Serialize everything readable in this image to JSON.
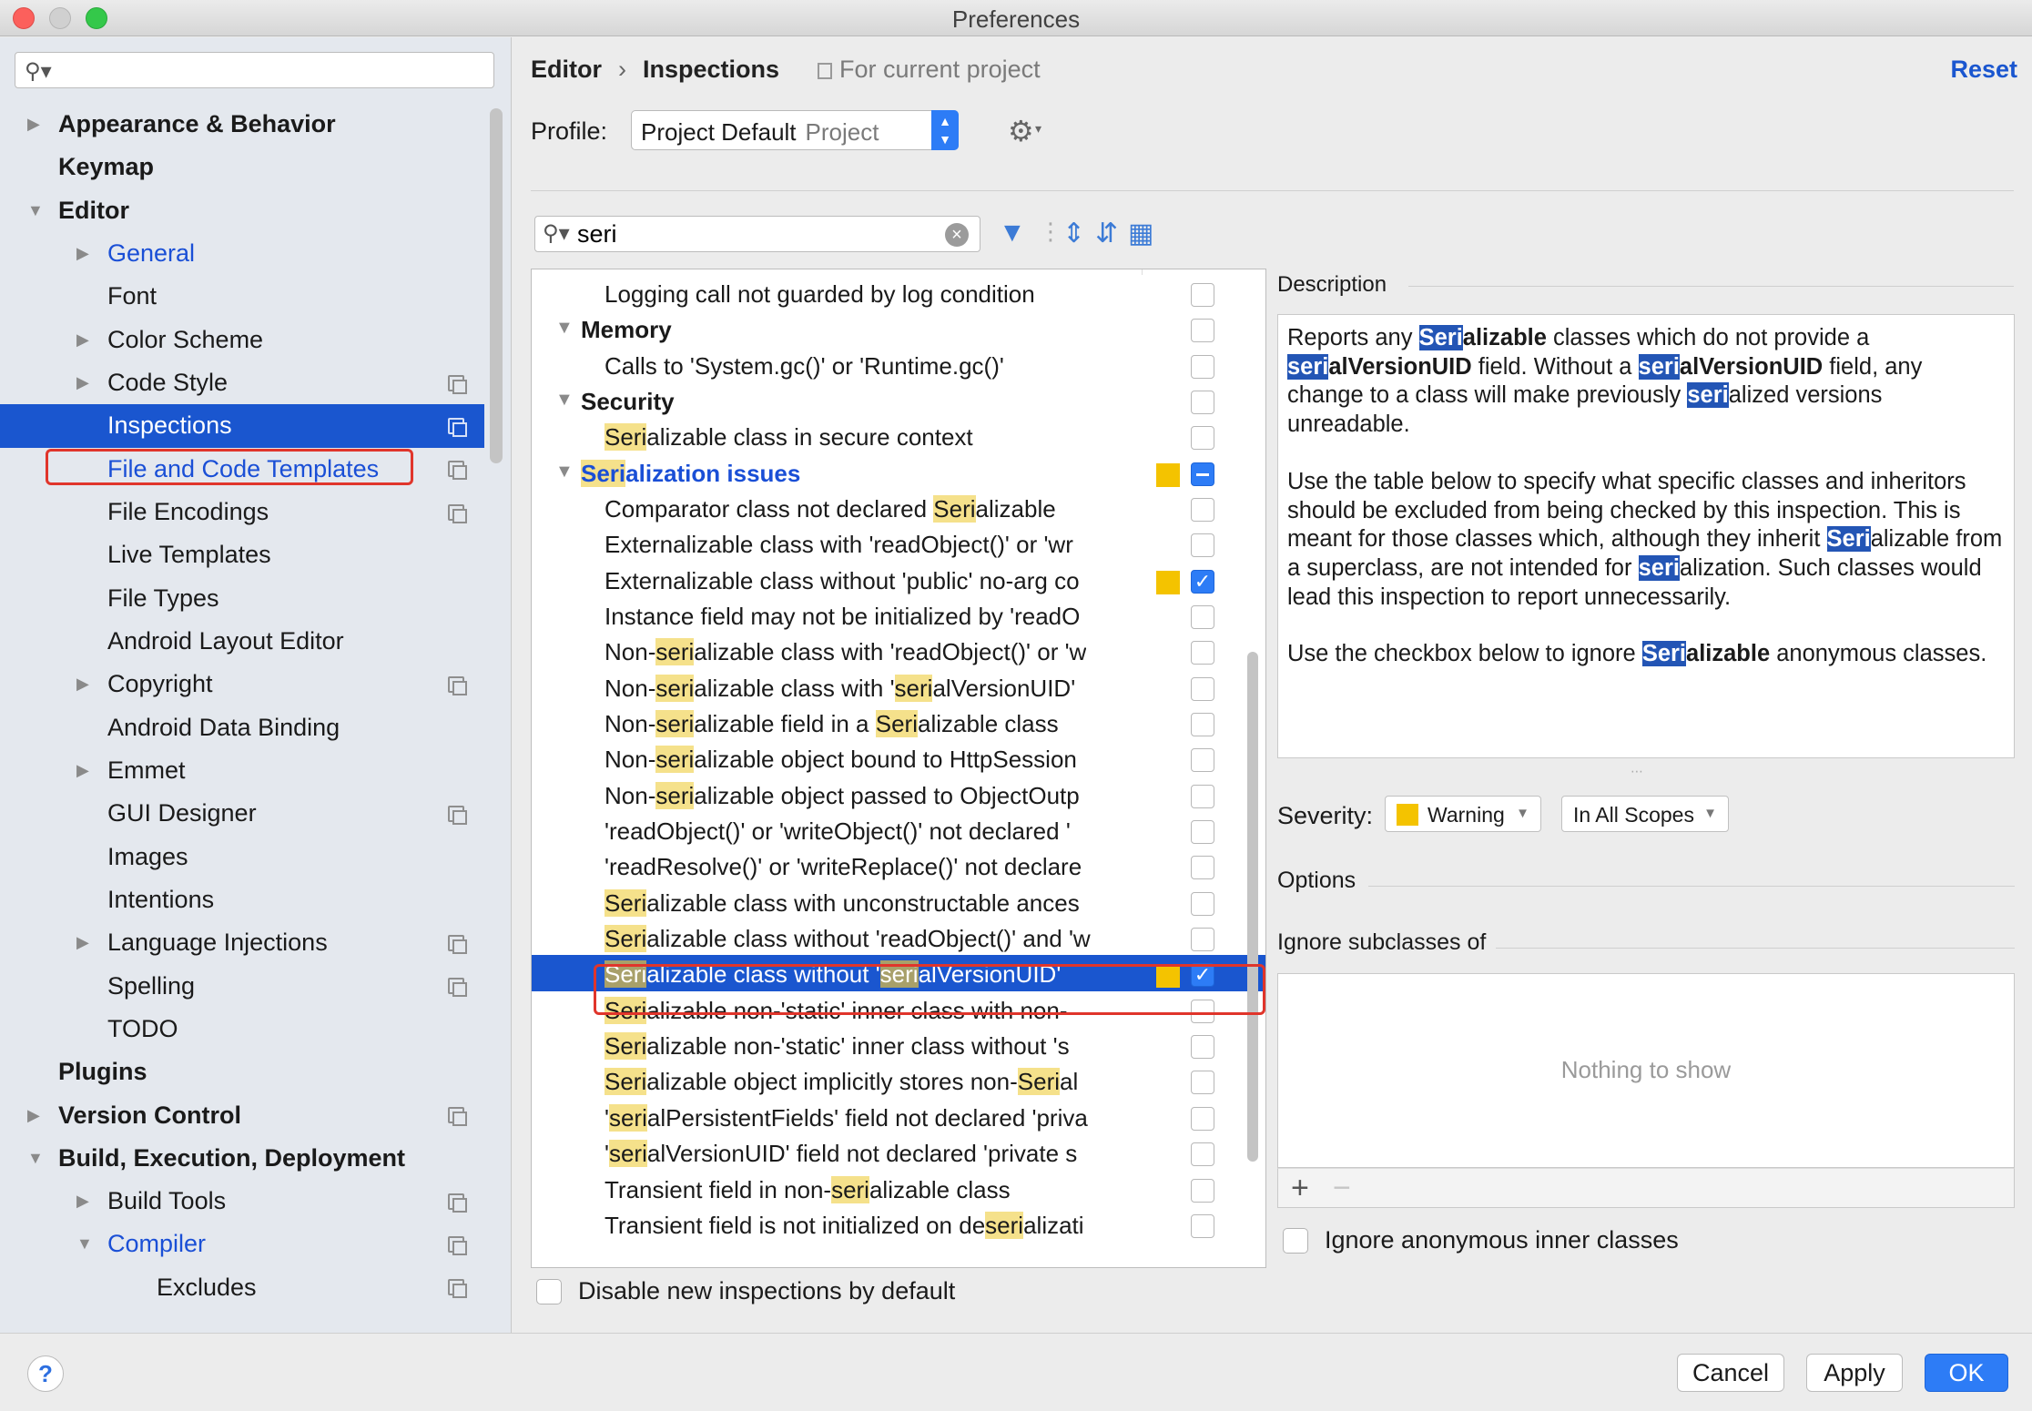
{
  "window": {
    "title": "Preferences"
  },
  "sidebar": {
    "search_placeholder": "",
    "items": [
      {
        "label": "Appearance & Behavior",
        "level": 0,
        "arrow": "right",
        "bold": true
      },
      {
        "label": "Keymap",
        "level": 0,
        "arrow": "",
        "bold": true
      },
      {
        "label": "Editor",
        "level": 0,
        "arrow": "down",
        "bold": true
      },
      {
        "label": "General",
        "level": 1,
        "arrow": "right",
        "link": true
      },
      {
        "label": "Font",
        "level": 1,
        "arrow": ""
      },
      {
        "label": "Color Scheme",
        "level": 1,
        "arrow": "right"
      },
      {
        "label": "Code Style",
        "level": 1,
        "arrow": "right",
        "copy": true
      },
      {
        "label": "Inspections",
        "level": 1,
        "arrow": "",
        "copy": true,
        "selected": true
      },
      {
        "label": "File and Code Templates",
        "level": 1,
        "arrow": "",
        "copy": true,
        "link": true
      },
      {
        "label": "File Encodings",
        "level": 1,
        "arrow": "",
        "copy": true
      },
      {
        "label": "Live Templates",
        "level": 1,
        "arrow": ""
      },
      {
        "label": "File Types",
        "level": 1,
        "arrow": ""
      },
      {
        "label": "Android Layout Editor",
        "level": 1,
        "arrow": ""
      },
      {
        "label": "Copyright",
        "level": 1,
        "arrow": "right",
        "copy": true
      },
      {
        "label": "Android Data Binding",
        "level": 1,
        "arrow": ""
      },
      {
        "label": "Emmet",
        "level": 1,
        "arrow": "right"
      },
      {
        "label": "GUI Designer",
        "level": 1,
        "arrow": "",
        "copy": true
      },
      {
        "label": "Images",
        "level": 1,
        "arrow": ""
      },
      {
        "label": "Intentions",
        "level": 1,
        "arrow": ""
      },
      {
        "label": "Language Injections",
        "level": 1,
        "arrow": "right",
        "copy": true
      },
      {
        "label": "Spelling",
        "level": 1,
        "arrow": "",
        "copy": true
      },
      {
        "label": "TODO",
        "level": 1,
        "arrow": ""
      },
      {
        "label": "Plugins",
        "level": 0,
        "arrow": "",
        "bold": true
      },
      {
        "label": "Version Control",
        "level": 0,
        "arrow": "right",
        "bold": true,
        "copy": true
      },
      {
        "label": "Build, Execution, Deployment",
        "level": 0,
        "arrow": "down",
        "bold": true
      },
      {
        "label": "Build Tools",
        "level": 1,
        "arrow": "right",
        "copy": true
      },
      {
        "label": "Compiler",
        "level": 1,
        "arrow": "down",
        "copy": true,
        "link": true
      },
      {
        "label": "Excludes",
        "level": 2,
        "arrow": "",
        "copy": true
      }
    ]
  },
  "header": {
    "crumb1": "Editor",
    "crumb_sep": "›",
    "crumb2": "Inspections",
    "scope_note": "For current project",
    "reset": "Reset"
  },
  "profile": {
    "label": "Profile:",
    "value": "Project Default",
    "scope": "Project"
  },
  "filter": {
    "value": "seri"
  },
  "inspections": [
    {
      "segments": [
        {
          "t": "Logging call not guarded by log condition"
        }
      ],
      "level": 1,
      "cb": "off"
    },
    {
      "segments": [
        {
          "t": "Memory"
        }
      ],
      "level": 0,
      "arrow": "down",
      "bold": true,
      "cb": "off"
    },
    {
      "segments": [
        {
          "t": "Calls to 'System.gc()' or 'Runtime.gc()'"
        }
      ],
      "level": 1,
      "cb": "off"
    },
    {
      "segments": [
        {
          "t": "Security"
        }
      ],
      "level": 0,
      "arrow": "down",
      "bold": true,
      "cb": "off"
    },
    {
      "segments": [
        {
          "t": "Seri",
          "hl": true
        },
        {
          "t": "alizable class in secure context"
        }
      ],
      "level": 1,
      "cb": "off"
    },
    {
      "segments": [
        {
          "t": "Seri",
          "hl": true
        },
        {
          "t": "alization issues"
        }
      ],
      "level": 0,
      "arrow": "down",
      "bold": true,
      "link": true,
      "sev": true,
      "cb": "mixed"
    },
    {
      "segments": [
        {
          "t": "Comparator class not declared "
        },
        {
          "t": "Seri",
          "hl": true
        },
        {
          "t": "alizable"
        }
      ],
      "level": 1,
      "cb": "off"
    },
    {
      "segments": [
        {
          "t": "Externalizable class with 'readObject()' or 'wr"
        }
      ],
      "level": 1,
      "cb": "off"
    },
    {
      "segments": [
        {
          "t": "Externalizable class without 'public' no-arg co"
        }
      ],
      "level": 1,
      "sev": true,
      "cb": "on"
    },
    {
      "segments": [
        {
          "t": "Instance field may not be initialized by 'readO"
        }
      ],
      "level": 1,
      "cb": "off"
    },
    {
      "segments": [
        {
          "t": "Non-"
        },
        {
          "t": "seri",
          "hl": true
        },
        {
          "t": "alizable class with 'readObject()' or 'w"
        }
      ],
      "level": 1,
      "cb": "off"
    },
    {
      "segments": [
        {
          "t": "Non-"
        },
        {
          "t": "seri",
          "hl": true
        },
        {
          "t": "alizable class with '"
        },
        {
          "t": "seri",
          "hl": true
        },
        {
          "t": "alVersionUID'"
        }
      ],
      "level": 1,
      "cb": "off"
    },
    {
      "segments": [
        {
          "t": "Non-"
        },
        {
          "t": "seri",
          "hl": true
        },
        {
          "t": "alizable field in a "
        },
        {
          "t": "Seri",
          "hl": true
        },
        {
          "t": "alizable class"
        }
      ],
      "level": 1,
      "cb": "off"
    },
    {
      "segments": [
        {
          "t": "Non-"
        },
        {
          "t": "seri",
          "hl": true
        },
        {
          "t": "alizable object bound to HttpSession"
        }
      ],
      "level": 1,
      "cb": "off"
    },
    {
      "segments": [
        {
          "t": "Non-"
        },
        {
          "t": "seri",
          "hl": true
        },
        {
          "t": "alizable object passed to ObjectOutp"
        }
      ],
      "level": 1,
      "cb": "off"
    },
    {
      "segments": [
        {
          "t": "'readObject()' or 'writeObject()' not declared '"
        }
      ],
      "level": 1,
      "cb": "off"
    },
    {
      "segments": [
        {
          "t": "'readResolve()' or 'writeReplace()' not declare"
        }
      ],
      "level": 1,
      "cb": "off"
    },
    {
      "segments": [
        {
          "t": "Seri",
          "hl": true
        },
        {
          "t": "alizable class with unconstructable ances"
        }
      ],
      "level": 1,
      "cb": "off"
    },
    {
      "segments": [
        {
          "t": "Seri",
          "hl": true
        },
        {
          "t": "alizable class without 'readObject()' and 'w"
        }
      ],
      "level": 1,
      "cb": "off"
    },
    {
      "segments": [
        {
          "t": "Seri",
          "hl": true
        },
        {
          "t": "alizable class without '"
        },
        {
          "t": "seri",
          "hl": true
        },
        {
          "t": "alVersionUID'"
        }
      ],
      "level": 1,
      "sev": true,
      "cb": "on",
      "selected": true
    },
    {
      "segments": [
        {
          "t": "Seri",
          "hl": true
        },
        {
          "t": "alizable non-'static' inner class with non-"
        }
      ],
      "level": 1,
      "cb": "off"
    },
    {
      "segments": [
        {
          "t": "Seri",
          "hl": true
        },
        {
          "t": "alizable non-'static' inner class without 's"
        }
      ],
      "level": 1,
      "cb": "off"
    },
    {
      "segments": [
        {
          "t": "Seri",
          "hl": true
        },
        {
          "t": "alizable object implicitly stores non-"
        },
        {
          "t": "Seri",
          "hl": true
        },
        {
          "t": "al"
        }
      ],
      "level": 1,
      "cb": "off"
    },
    {
      "segments": [
        {
          "t": "'"
        },
        {
          "t": "seri",
          "hl": true
        },
        {
          "t": "alPersistentFields' field not declared 'priva"
        }
      ],
      "level": 1,
      "cb": "off"
    },
    {
      "segments": [
        {
          "t": "'"
        },
        {
          "t": "seri",
          "hl": true
        },
        {
          "t": "alVersionUID' field not declared 'private s"
        }
      ],
      "level": 1,
      "cb": "off"
    },
    {
      "segments": [
        {
          "t": "Transient field in non-"
        },
        {
          "t": "seri",
          "hl": true
        },
        {
          "t": "alizable class"
        }
      ],
      "level": 1,
      "cb": "off"
    },
    {
      "segments": [
        {
          "t": "Transient field is not initialized on de"
        },
        {
          "t": "seri",
          "hl": true
        },
        {
          "t": "alizati"
        }
      ],
      "level": 1,
      "cb": "off"
    }
  ],
  "disable_new": {
    "label": "Disable new inspections by default"
  },
  "description": {
    "title": "Description",
    "paragraphs": [
      [
        {
          "t": "Reports any "
        },
        {
          "t": "Seri",
          "kw": true
        },
        {
          "t": "alizable",
          "b": true
        },
        {
          "t": " classes which do not provide a "
        },
        {
          "t": "seri",
          "kw": true
        },
        {
          "t": "alVersionUID",
          "b": true
        },
        {
          "t": " field. Without a "
        },
        {
          "t": "seri",
          "kw": true
        },
        {
          "t": "alVersionUID",
          "b": true
        },
        {
          "t": " field, any change to a class will make previously "
        },
        {
          "t": "seri",
          "kw": true
        },
        {
          "t": "alized versions unreadable."
        }
      ],
      [
        {
          "t": "Use the table below to specify what specific classes and inheritors should be excluded from being checked by this inspection. This is meant for those classes which, although they inherit "
        },
        {
          "t": "Seri",
          "kw": true
        },
        {
          "t": "alizable from a superclass, are not intended for "
        },
        {
          "t": "seri",
          "kw": true
        },
        {
          "t": "alization. Such classes would lead this inspection to report unnecessarily."
        }
      ],
      [
        {
          "t": "Use the checkbox below to ignore "
        },
        {
          "t": "Seri",
          "kw": true
        },
        {
          "t": "alizable",
          "b": true
        },
        {
          "t": " anonymous classes."
        }
      ]
    ]
  },
  "severity": {
    "label": "Severity:",
    "value": "Warning",
    "scope": "In All Scopes",
    "color": "#f4c300"
  },
  "options": {
    "label": "Options"
  },
  "ignore_subclasses": {
    "label": "Ignore subclasses of",
    "empty": "Nothing to show",
    "add": "+",
    "remove": "−"
  },
  "ignore_anonymous": {
    "label": "Ignore anonymous inner classes"
  },
  "buttons": {
    "help": "?",
    "cancel": "Cancel",
    "apply": "Apply",
    "ok": "OK"
  },
  "colors": {
    "selection": "#1a56cf",
    "accent": "#2d7cf6",
    "highlight": "#f5e18b",
    "outline": "#e0352b"
  }
}
